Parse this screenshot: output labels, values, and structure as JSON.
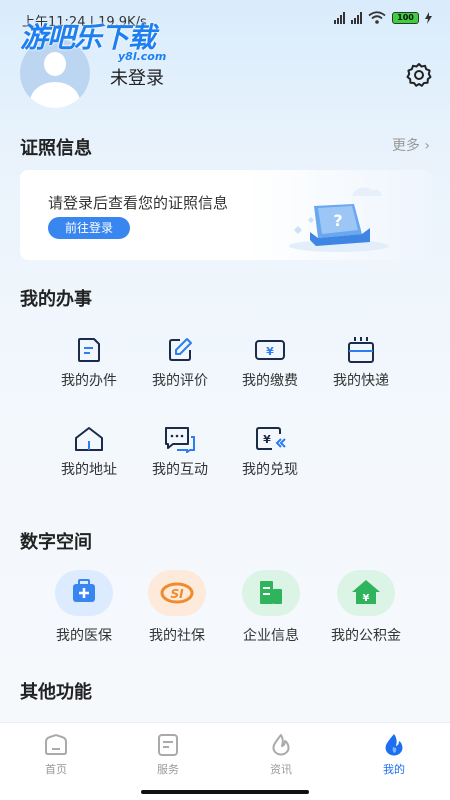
{
  "status_bar": {
    "time_speed": "上午11:24 | 19.9K/s",
    "battery": "100"
  },
  "watermark": {
    "title": "游吧乐下载",
    "sub": "y8l.com"
  },
  "header": {
    "login_status": "未登录"
  },
  "license": {
    "title": "证照信息",
    "more": "更多 ›",
    "card_text": "请登录后查看您的证照信息",
    "login_button": "前往登录"
  },
  "my_affairs": {
    "title": "我的办事",
    "items": [
      {
        "label": "我的办件",
        "icon": "document-icon"
      },
      {
        "label": "我的评价",
        "icon": "edit-icon"
      },
      {
        "label": "我的缴费",
        "icon": "yuan-card-icon"
      },
      {
        "label": "我的快递",
        "icon": "parcel-icon"
      },
      {
        "label": "我的地址",
        "icon": "house-icon"
      },
      {
        "label": "我的互动",
        "icon": "chat-icon"
      },
      {
        "label": "我的兑现",
        "icon": "yuan-return-icon"
      }
    ]
  },
  "digital_space": {
    "title": "数字空间",
    "items": [
      {
        "label": "我的医保",
        "icon": "medical-kit-icon",
        "color": "#3a86f0",
        "bg": "#dcebfd"
      },
      {
        "label": "我的社保",
        "icon": "social-security-icon",
        "color": "#f08a2c",
        "bg": "#fdeadb"
      },
      {
        "label": "企业信息",
        "icon": "building-icon",
        "color": "#2fb35d",
        "bg": "#dcf4e5"
      },
      {
        "label": "我的公积金",
        "icon": "housing-fund-icon",
        "color": "#2fb35d",
        "bg": "#dcf4e5"
      }
    ]
  },
  "other": {
    "title": "其他功能"
  },
  "tabbar": {
    "tabs": [
      {
        "label": "首页",
        "icon": "home-icon"
      },
      {
        "label": "服务",
        "icon": "service-icon"
      },
      {
        "label": "资讯",
        "icon": "news-icon"
      },
      {
        "label": "我的",
        "icon": "mine-icon",
        "active": true
      }
    ]
  }
}
